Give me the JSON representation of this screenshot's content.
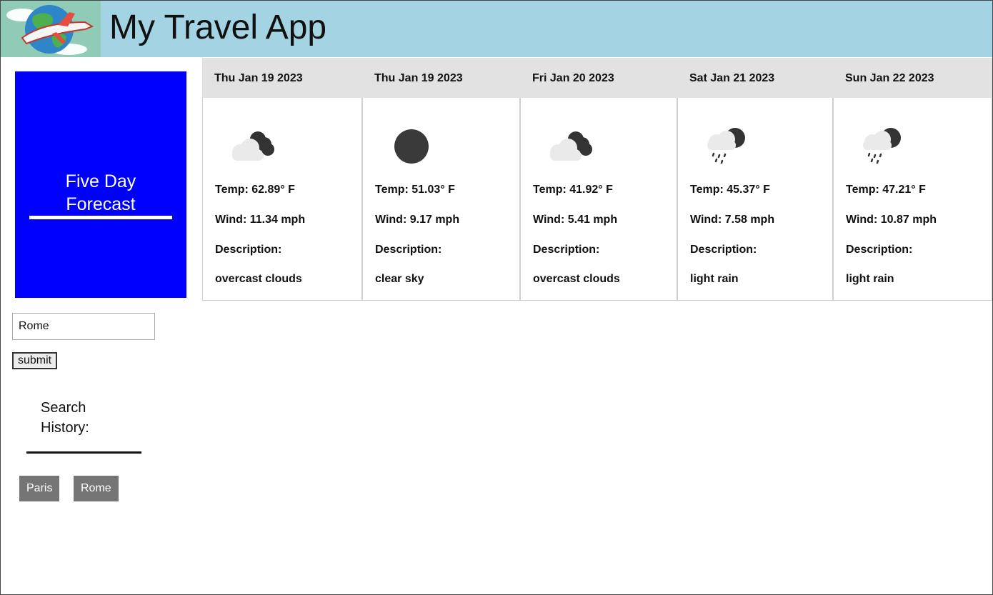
{
  "header": {
    "title": "My Travel App"
  },
  "sidebar": {
    "forecast_label": "Five Day Forecast",
    "search": {
      "value": "Rome",
      "submit_label": "submit"
    },
    "history_title_line1": "Search",
    "history_title_line2": "History:",
    "history": [
      "Paris",
      "Rome"
    ]
  },
  "labels": {
    "description": "Description:"
  },
  "days": [
    {
      "date": "Thu Jan 19 2023",
      "temp": "Temp: 62.89° F",
      "wind": "Wind: 11.34 mph",
      "description": "overcast clouds",
      "icon": "overcast-clouds-icon"
    },
    {
      "date": "Thu Jan 19 2023",
      "temp": "Temp: 51.03° F",
      "wind": "Wind: 9.17 mph",
      "description": "clear sky",
      "icon": "clear-sky-icon"
    },
    {
      "date": "Fri Jan 20 2023",
      "temp": "Temp: 41.92° F",
      "wind": "Wind: 5.41 mph",
      "description": "overcast clouds",
      "icon": "overcast-clouds-icon"
    },
    {
      "date": "Sat Jan 21 2023",
      "temp": "Temp: 45.37° F",
      "wind": "Wind: 7.58 mph",
      "description": "light rain",
      "icon": "light-rain-icon"
    },
    {
      "date": "Sun Jan 22 2023",
      "temp": "Temp: 47.21° F",
      "wind": "Wind: 10.87 mph",
      "description": "light rain",
      "icon": "light-rain-icon"
    }
  ],
  "colors": {
    "header_bg": "#a4d4e3",
    "forecast_bg": "#0000ff",
    "day_header_bg": "#e2e2e2",
    "history_btn_bg": "#757575"
  }
}
